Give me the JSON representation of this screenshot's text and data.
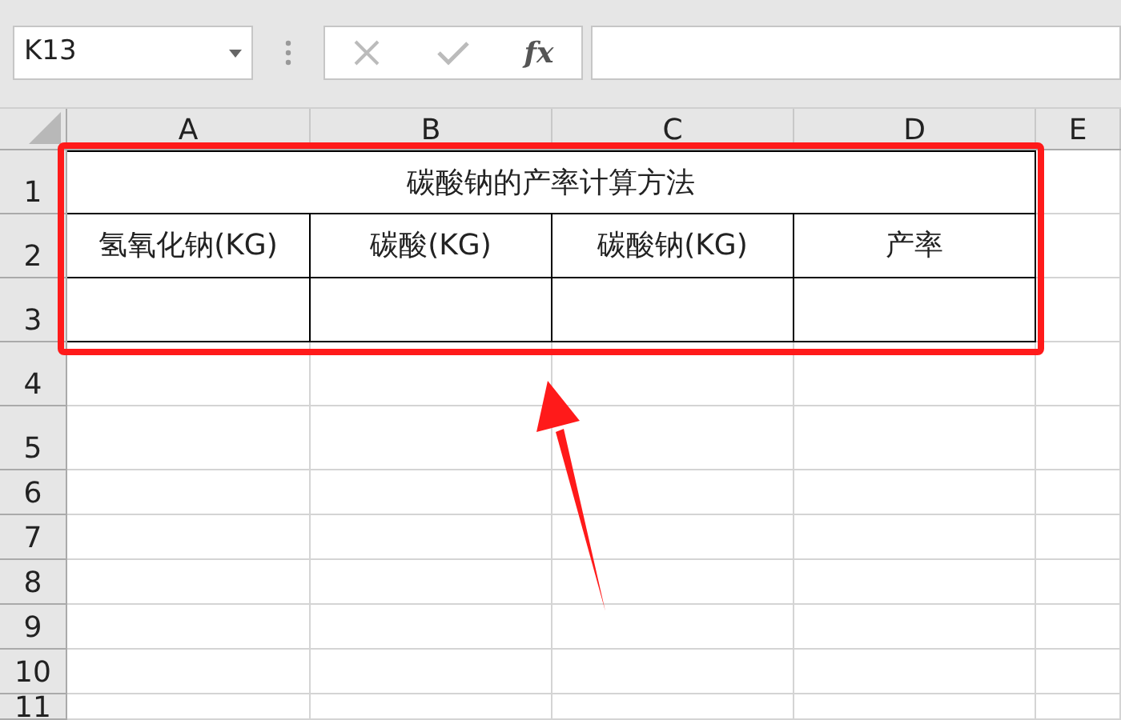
{
  "name_box": {
    "value": "K13"
  },
  "formula_bar": {
    "function_label": "fx"
  },
  "columns": [
    "A",
    "B",
    "C",
    "D",
    "E"
  ],
  "rows": [
    "1",
    "2",
    "3",
    "4",
    "5",
    "6",
    "7",
    "8",
    "9",
    "10",
    "11"
  ],
  "table": {
    "title": "碳酸钠的产率计算方法",
    "headers": [
      "氢氧化钠(KG)",
      "碳酸(KG)",
      "碳酸钠(KG)",
      "产率"
    ]
  }
}
